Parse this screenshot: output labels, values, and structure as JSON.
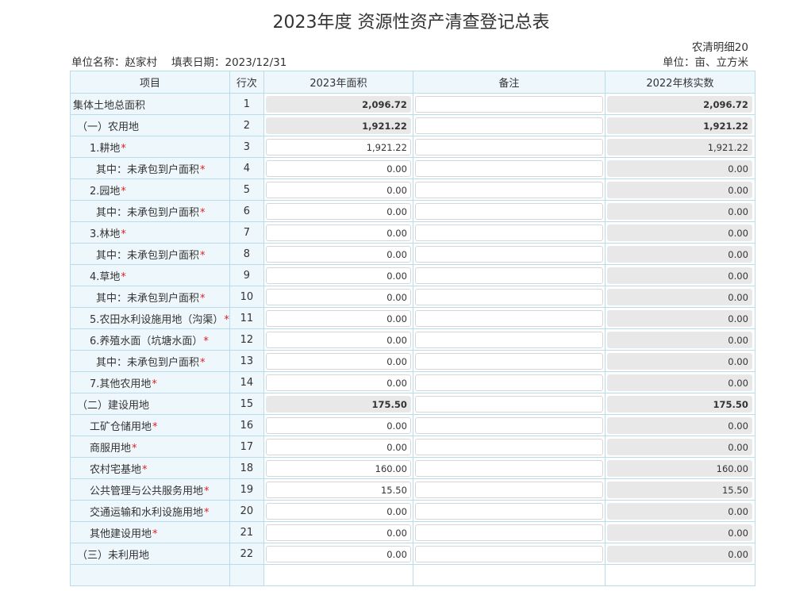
{
  "title": "2023年度 资源性资产清查登记总表",
  "form_code": "农清明细20",
  "unit_label": "单位名称：赵家村",
  "date_label": "填表日期：2023/12/31",
  "measure_unit": "单位：亩、立方米",
  "headers": {
    "item": "项目",
    "row_no": "行次",
    "area_2023": "2023年面积",
    "remark": "备注",
    "verified_2022": "2022年核实数"
  },
  "rows": [
    {
      "label": "集体土地总面积",
      "required": false,
      "row_no": "1",
      "area": "2,096.72",
      "prev": "2,096.72"
    },
    {
      "label": "（一）农用地",
      "required": false,
      "row_no": "2",
      "area": "1,921.22",
      "prev": "1,921.22"
    },
    {
      "label": "1.耕地",
      "required": true,
      "row_no": "3",
      "area": "1,921.22",
      "prev": "1,921.22"
    },
    {
      "label": "其中：未承包到户面积",
      "required": true,
      "row_no": "4",
      "area": "0.00",
      "prev": "0.00"
    },
    {
      "label": "2.园地",
      "required": true,
      "row_no": "5",
      "area": "0.00",
      "prev": "0.00"
    },
    {
      "label": "其中：未承包到户面积",
      "required": true,
      "row_no": "6",
      "area": "0.00",
      "prev": "0.00"
    },
    {
      "label": "3.林地",
      "required": true,
      "row_no": "7",
      "area": "0.00",
      "prev": "0.00"
    },
    {
      "label": "其中：未承包到户面积",
      "required": true,
      "row_no": "8",
      "area": "0.00",
      "prev": "0.00"
    },
    {
      "label": "4.草地",
      "required": true,
      "row_no": "9",
      "area": "0.00",
      "prev": "0.00"
    },
    {
      "label": "其中：未承包到户面积",
      "required": true,
      "row_no": "10",
      "area": "0.00",
      "prev": "0.00"
    },
    {
      "label": "5.农田水利设施用地（沟渠）",
      "required": true,
      "row_no": "11",
      "area": "0.00",
      "prev": "0.00"
    },
    {
      "label": "6.养殖水面（坑塘水面）",
      "required": true,
      "row_no": "12",
      "area": "0.00",
      "prev": "0.00"
    },
    {
      "label": "其中：未承包到户面积",
      "required": true,
      "row_no": "13",
      "area": "0.00",
      "prev": "0.00"
    },
    {
      "label": "7.其他农用地",
      "required": true,
      "row_no": "14",
      "area": "0.00",
      "prev": "0.00"
    },
    {
      "label": "（二）建设用地",
      "required": false,
      "row_no": "15",
      "area": "175.50",
      "prev": "175.50"
    },
    {
      "label": "工矿仓储用地",
      "required": true,
      "row_no": "16",
      "area": "0.00",
      "prev": "0.00"
    },
    {
      "label": "商服用地",
      "required": true,
      "row_no": "17",
      "area": "0.00",
      "prev": "0.00"
    },
    {
      "label": "农村宅基地",
      "required": true,
      "row_no": "18",
      "area": "160.00",
      "prev": "160.00"
    },
    {
      "label": "公共管理与公共服务用地",
      "required": true,
      "row_no": "19",
      "area": "15.50",
      "prev": "15.50"
    },
    {
      "label": "交通运输和水利设施用地",
      "required": true,
      "row_no": "20",
      "area": "0.00",
      "prev": "0.00"
    },
    {
      "label": "其他建设用地",
      "required": true,
      "row_no": "21",
      "area": "0.00",
      "prev": "0.00"
    },
    {
      "label": "（三）未利用地",
      "required": false,
      "row_no": "22",
      "area": "0.00",
      "prev": "0.00"
    }
  ]
}
